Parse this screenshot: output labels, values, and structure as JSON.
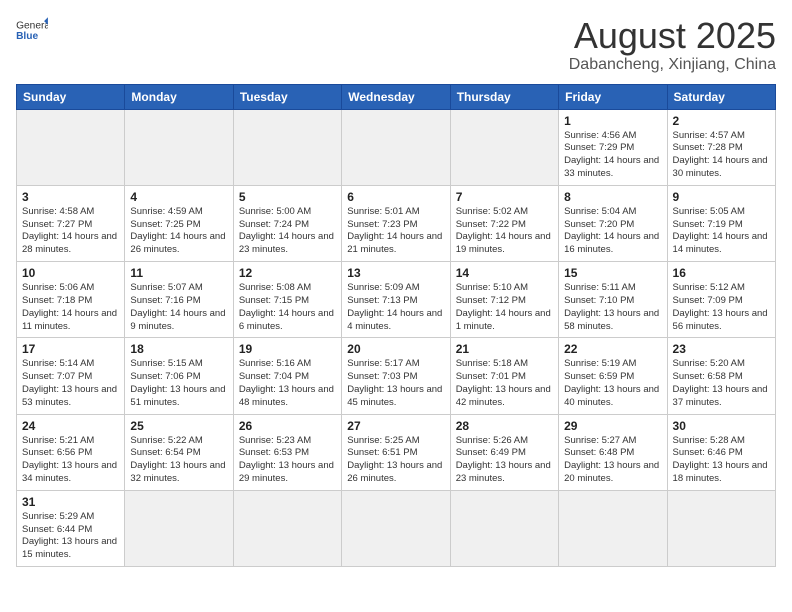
{
  "header": {
    "logo_general": "General",
    "logo_blue": "Blue",
    "month_title": "August 2025",
    "location": "Dabancheng, Xinjiang, China"
  },
  "weekdays": [
    "Sunday",
    "Monday",
    "Tuesday",
    "Wednesday",
    "Thursday",
    "Friday",
    "Saturday"
  ],
  "weeks": [
    [
      {
        "day": "",
        "info": ""
      },
      {
        "day": "",
        "info": ""
      },
      {
        "day": "",
        "info": ""
      },
      {
        "day": "",
        "info": ""
      },
      {
        "day": "",
        "info": ""
      },
      {
        "day": "1",
        "info": "Sunrise: 4:56 AM\nSunset: 7:29 PM\nDaylight: 14 hours and 33 minutes."
      },
      {
        "day": "2",
        "info": "Sunrise: 4:57 AM\nSunset: 7:28 PM\nDaylight: 14 hours and 30 minutes."
      }
    ],
    [
      {
        "day": "3",
        "info": "Sunrise: 4:58 AM\nSunset: 7:27 PM\nDaylight: 14 hours and 28 minutes."
      },
      {
        "day": "4",
        "info": "Sunrise: 4:59 AM\nSunset: 7:25 PM\nDaylight: 14 hours and 26 minutes."
      },
      {
        "day": "5",
        "info": "Sunrise: 5:00 AM\nSunset: 7:24 PM\nDaylight: 14 hours and 23 minutes."
      },
      {
        "day": "6",
        "info": "Sunrise: 5:01 AM\nSunset: 7:23 PM\nDaylight: 14 hours and 21 minutes."
      },
      {
        "day": "7",
        "info": "Sunrise: 5:02 AM\nSunset: 7:22 PM\nDaylight: 14 hours and 19 minutes."
      },
      {
        "day": "8",
        "info": "Sunrise: 5:04 AM\nSunset: 7:20 PM\nDaylight: 14 hours and 16 minutes."
      },
      {
        "day": "9",
        "info": "Sunrise: 5:05 AM\nSunset: 7:19 PM\nDaylight: 14 hours and 14 minutes."
      }
    ],
    [
      {
        "day": "10",
        "info": "Sunrise: 5:06 AM\nSunset: 7:18 PM\nDaylight: 14 hours and 11 minutes."
      },
      {
        "day": "11",
        "info": "Sunrise: 5:07 AM\nSunset: 7:16 PM\nDaylight: 14 hours and 9 minutes."
      },
      {
        "day": "12",
        "info": "Sunrise: 5:08 AM\nSunset: 7:15 PM\nDaylight: 14 hours and 6 minutes."
      },
      {
        "day": "13",
        "info": "Sunrise: 5:09 AM\nSunset: 7:13 PM\nDaylight: 14 hours and 4 minutes."
      },
      {
        "day": "14",
        "info": "Sunrise: 5:10 AM\nSunset: 7:12 PM\nDaylight: 14 hours and 1 minute."
      },
      {
        "day": "15",
        "info": "Sunrise: 5:11 AM\nSunset: 7:10 PM\nDaylight: 13 hours and 58 minutes."
      },
      {
        "day": "16",
        "info": "Sunrise: 5:12 AM\nSunset: 7:09 PM\nDaylight: 13 hours and 56 minutes."
      }
    ],
    [
      {
        "day": "17",
        "info": "Sunrise: 5:14 AM\nSunset: 7:07 PM\nDaylight: 13 hours and 53 minutes."
      },
      {
        "day": "18",
        "info": "Sunrise: 5:15 AM\nSunset: 7:06 PM\nDaylight: 13 hours and 51 minutes."
      },
      {
        "day": "19",
        "info": "Sunrise: 5:16 AM\nSunset: 7:04 PM\nDaylight: 13 hours and 48 minutes."
      },
      {
        "day": "20",
        "info": "Sunrise: 5:17 AM\nSunset: 7:03 PM\nDaylight: 13 hours and 45 minutes."
      },
      {
        "day": "21",
        "info": "Sunrise: 5:18 AM\nSunset: 7:01 PM\nDaylight: 13 hours and 42 minutes."
      },
      {
        "day": "22",
        "info": "Sunrise: 5:19 AM\nSunset: 6:59 PM\nDaylight: 13 hours and 40 minutes."
      },
      {
        "day": "23",
        "info": "Sunrise: 5:20 AM\nSunset: 6:58 PM\nDaylight: 13 hours and 37 minutes."
      }
    ],
    [
      {
        "day": "24",
        "info": "Sunrise: 5:21 AM\nSunset: 6:56 PM\nDaylight: 13 hours and 34 minutes."
      },
      {
        "day": "25",
        "info": "Sunrise: 5:22 AM\nSunset: 6:54 PM\nDaylight: 13 hours and 32 minutes."
      },
      {
        "day": "26",
        "info": "Sunrise: 5:23 AM\nSunset: 6:53 PM\nDaylight: 13 hours and 29 minutes."
      },
      {
        "day": "27",
        "info": "Sunrise: 5:25 AM\nSunset: 6:51 PM\nDaylight: 13 hours and 26 minutes."
      },
      {
        "day": "28",
        "info": "Sunrise: 5:26 AM\nSunset: 6:49 PM\nDaylight: 13 hours and 23 minutes."
      },
      {
        "day": "29",
        "info": "Sunrise: 5:27 AM\nSunset: 6:48 PM\nDaylight: 13 hours and 20 minutes."
      },
      {
        "day": "30",
        "info": "Sunrise: 5:28 AM\nSunset: 6:46 PM\nDaylight: 13 hours and 18 minutes."
      }
    ],
    [
      {
        "day": "31",
        "info": "Sunrise: 5:29 AM\nSunset: 6:44 PM\nDaylight: 13 hours and 15 minutes."
      },
      {
        "day": "",
        "info": ""
      },
      {
        "day": "",
        "info": ""
      },
      {
        "day": "",
        "info": ""
      },
      {
        "day": "",
        "info": ""
      },
      {
        "day": "",
        "info": ""
      },
      {
        "day": "",
        "info": ""
      }
    ]
  ]
}
